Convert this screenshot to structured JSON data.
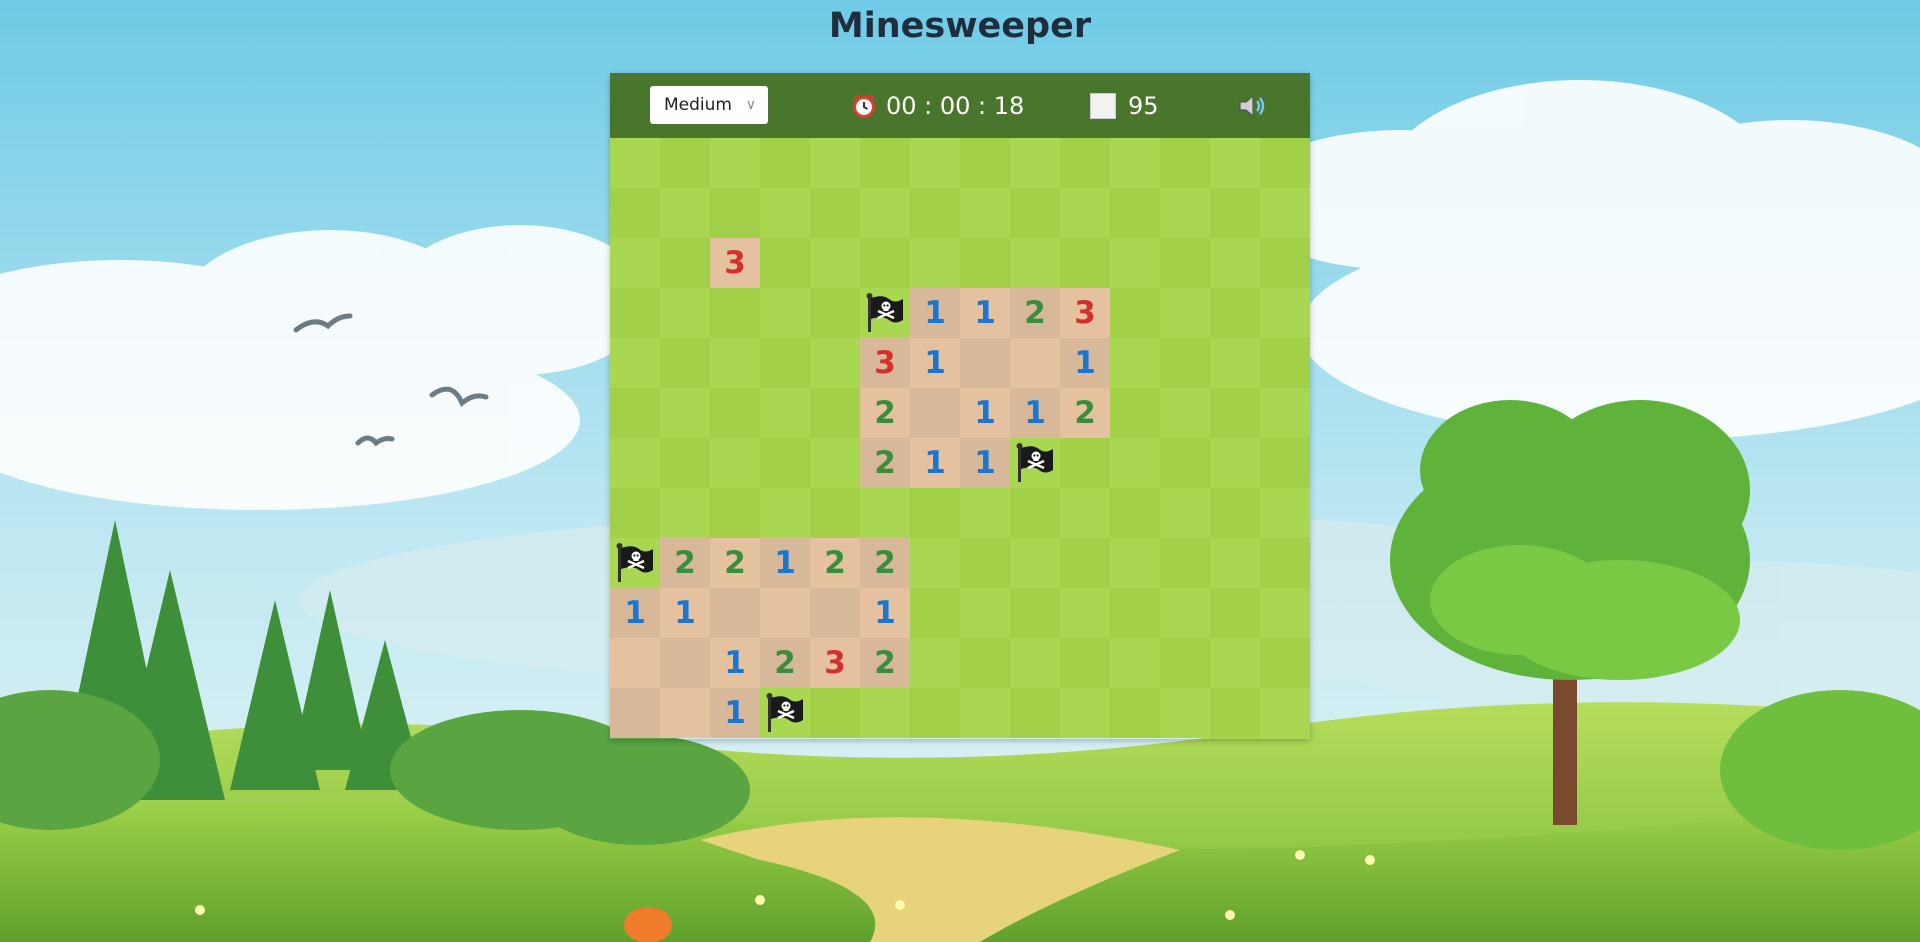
{
  "title": "Minesweeper",
  "header": {
    "difficulty": "Medium",
    "timer": "00 : 00 : 18",
    "flags_remaining": "95",
    "icons": {
      "timer": "alarm-clock-icon",
      "flags": "square-icon",
      "sound": "speaker-icon"
    }
  },
  "board": {
    "rows": 12,
    "cols": 14,
    "cells": [
      "..............",
      "..............",
      "..3...........",
      ".....F1123....",
      ".....31__1....",
      ".....2_112....",
      ".....211F.....",
      "..............",
      "F22122........",
      "11___1........",
      "__1232........",
      "__1F.........."
    ],
    "legend": {
      ".": "unrevealed",
      "_": "revealed-empty",
      "F": "flagged",
      "1-8": "revealed-number"
    }
  },
  "colors": {
    "header": "#4a752c",
    "grass_light": "#aad751",
    "grass_dark": "#a2d149",
    "dirt_light": "#e5c29f",
    "dirt_dark": "#d7b899",
    "n1": "#1976d2",
    "n2": "#388e3c",
    "n3": "#d32f2f"
  }
}
